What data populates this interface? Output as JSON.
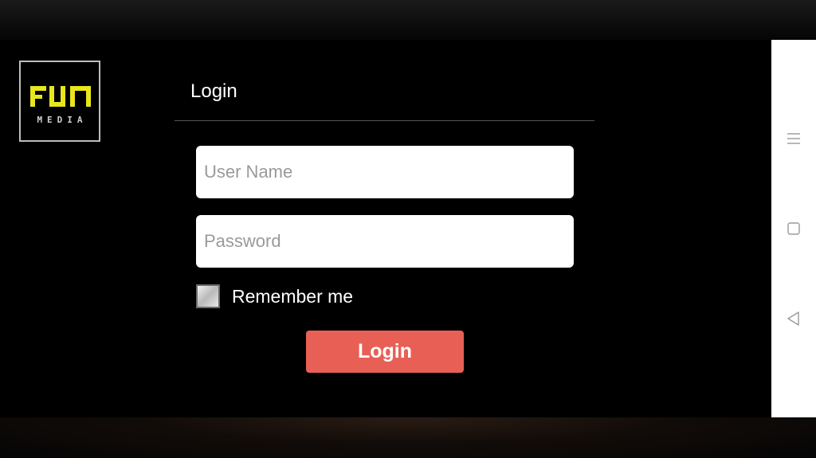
{
  "brand": {
    "logo_text": "FUN",
    "logo_subtext": "MEDIA",
    "logo_color": "#e8e61c"
  },
  "login": {
    "title": "Login",
    "username_placeholder": "User Name",
    "username_value": "",
    "password_placeholder": "Password",
    "password_value": "",
    "remember_label": "Remember me",
    "remember_checked": false,
    "submit_label": "Login",
    "accent_color": "#e86055"
  },
  "system_nav": {
    "buttons": [
      {
        "icon": "menu-icon"
      },
      {
        "icon": "home-square-icon"
      },
      {
        "icon": "back-triangle-icon"
      }
    ]
  }
}
